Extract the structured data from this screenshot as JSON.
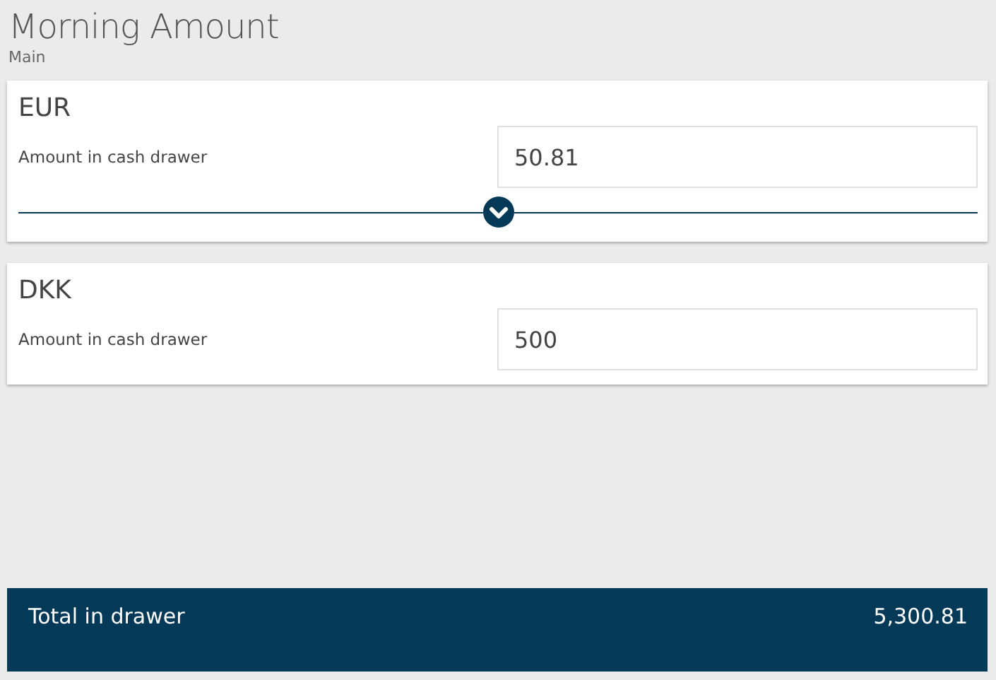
{
  "header": {
    "title": "Morning Amount",
    "subtitle": "Main"
  },
  "currencies": [
    {
      "kind": "expandable",
      "code": "EUR",
      "label": "Amount in cash drawer",
      "value": "50.81",
      "expanded": false
    },
    {
      "kind": "plain",
      "code": "DKK",
      "label": "Amount in cash drawer",
      "value": "500"
    }
  ],
  "total": {
    "label": "Total in drawer",
    "value": "5,300.81"
  }
}
